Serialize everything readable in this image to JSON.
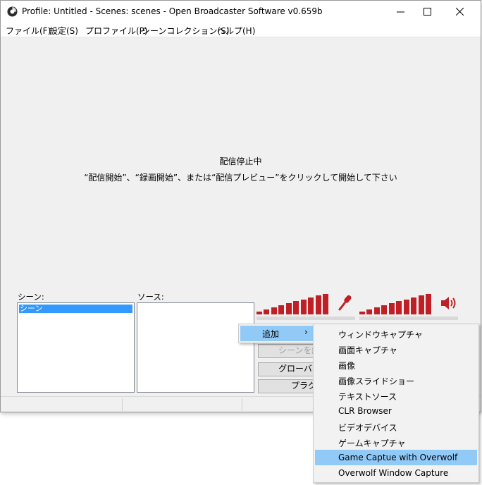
{
  "window": {
    "title": "Profile: Untitled - Scenes: scenes - Open Broadcaster Software v0.659b"
  },
  "menubar": [
    "ファイル(F)",
    "設定(S)",
    "プロファイル(P)",
    "シーンコレクション(S)",
    "ヘルプ(H)"
  ],
  "preview": {
    "status": "配信停止中",
    "hint": "“配信開始”、“録画開始”、または“配信プレビュー”をクリックして開始して下さい"
  },
  "scenes": {
    "label": "シーン:",
    "items": [
      "シーン"
    ]
  },
  "sources": {
    "label": "ソース:"
  },
  "buttons": {
    "edit_scene": "シーンを編",
    "global_sources": "グローバル",
    "plugins": "プラグイ"
  },
  "context_menu": {
    "add": "追加",
    "submenu": [
      "ウィンドウキャプチャ",
      "画面キャプチャ",
      "画像",
      "画像スライドショー",
      "テキストソース",
      "CLR Browser",
      "ビデオデバイス",
      "ゲームキャプチャ",
      "Game Captue with Overwolf",
      "Overwolf Window Capture"
    ],
    "highlighted_index": 8
  },
  "icons": {
    "app": "obs-logo-icon",
    "mic": "microphone-icon",
    "speaker": "speaker-icon",
    "submenu_arrow": "chevron-right-icon"
  },
  "colors": {
    "meter_bar": "#bf2026",
    "selection": "#3399ff",
    "menu_highlight": "#91c9f7"
  }
}
